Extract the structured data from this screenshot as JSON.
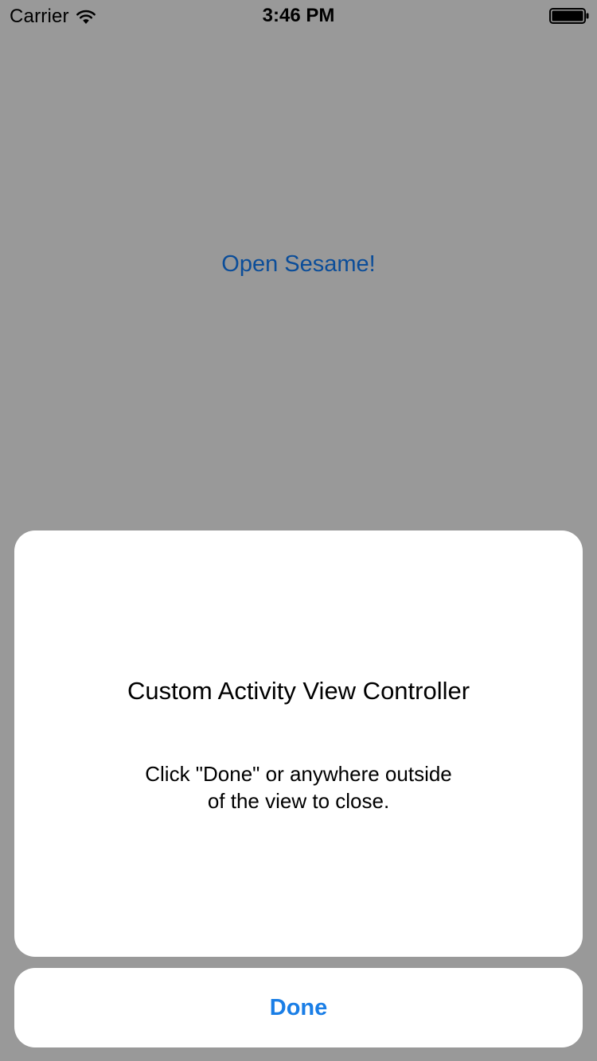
{
  "status_bar": {
    "carrier": "Carrier",
    "time": "3:46 PM",
    "wifi_icon": "wifi-icon",
    "battery_icon": "battery-full-icon"
  },
  "background": {
    "link_label": "Open Sesame!"
  },
  "sheet": {
    "title": "Custom Activity View Controller",
    "message_line1": "Click \"Done\" or anywhere outside",
    "message_line2": "of the view to close.",
    "done_label": "Done"
  },
  "colors": {
    "dim_overlay": "#999999",
    "link": "#0b4d99",
    "done_accent": "#1a7ee6",
    "card": "#ffffff"
  }
}
